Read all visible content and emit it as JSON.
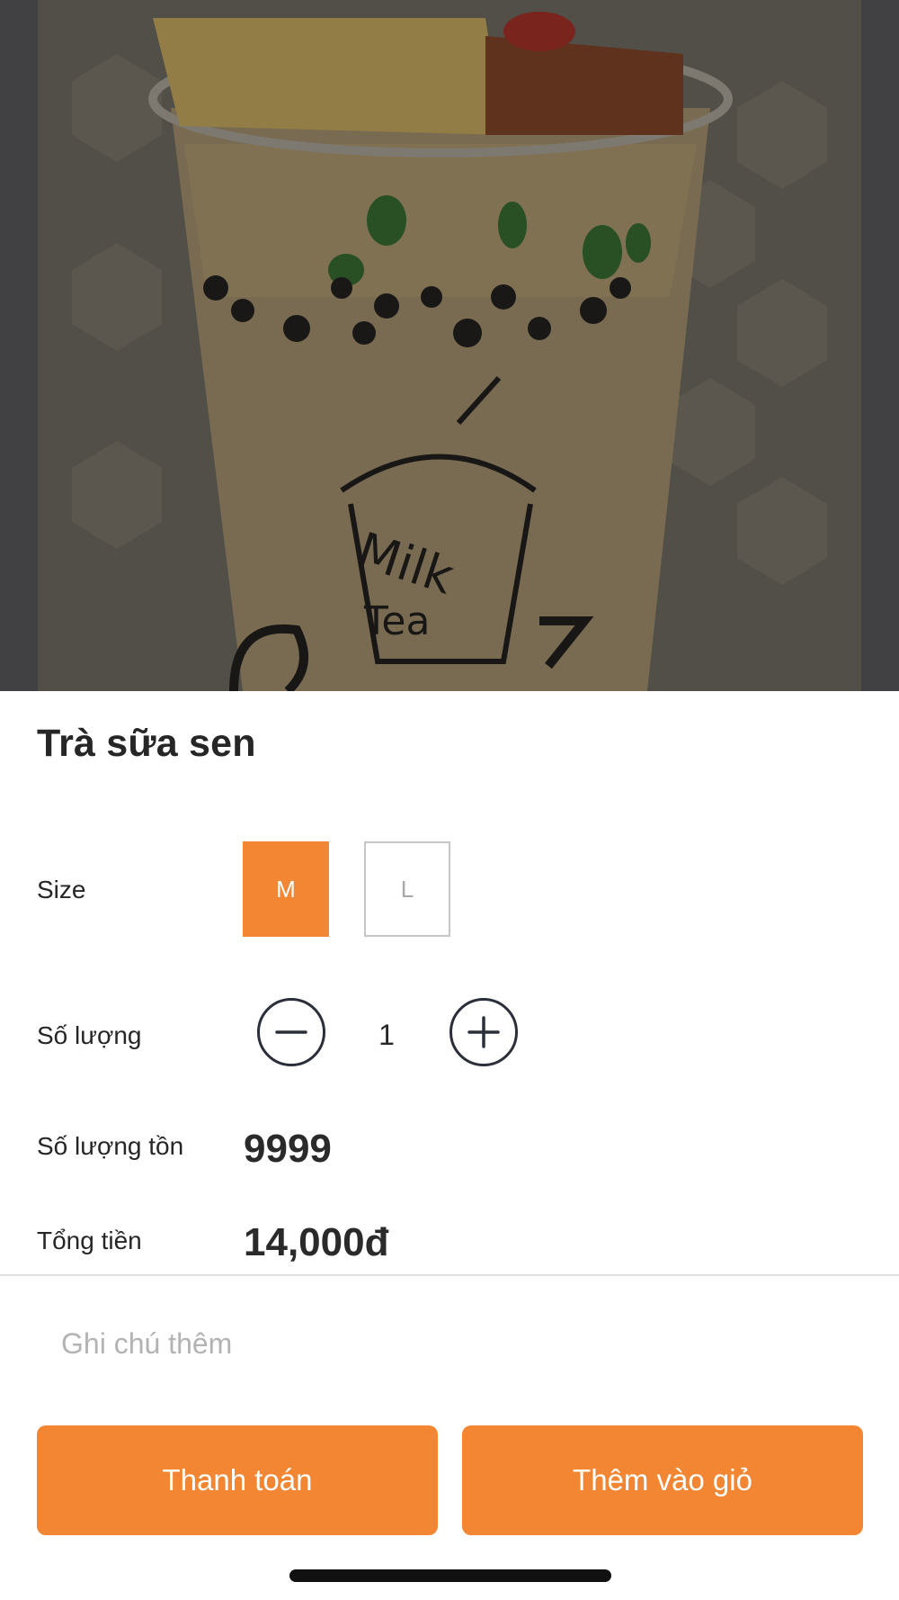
{
  "product": {
    "name": "Trà sữa sen",
    "photo_alt": "Milk Tea"
  },
  "size": {
    "label": "Size",
    "options": [
      "M",
      "L"
    ],
    "selected": "M"
  },
  "quantity": {
    "label": "Số lượng",
    "value": "1"
  },
  "stock": {
    "label": "Số lượng tồn",
    "value": "9999"
  },
  "total": {
    "label": "Tổng tiền",
    "value": "14,000đ"
  },
  "note": {
    "placeholder": "Ghi chú thêm",
    "value": ""
  },
  "actions": {
    "checkout_label": "Thanh toán",
    "add_to_cart_label": "Thêm vào giỏ"
  },
  "colors": {
    "accent": "#f28633",
    "text": "#262626",
    "muted": "#b3b3b3"
  }
}
